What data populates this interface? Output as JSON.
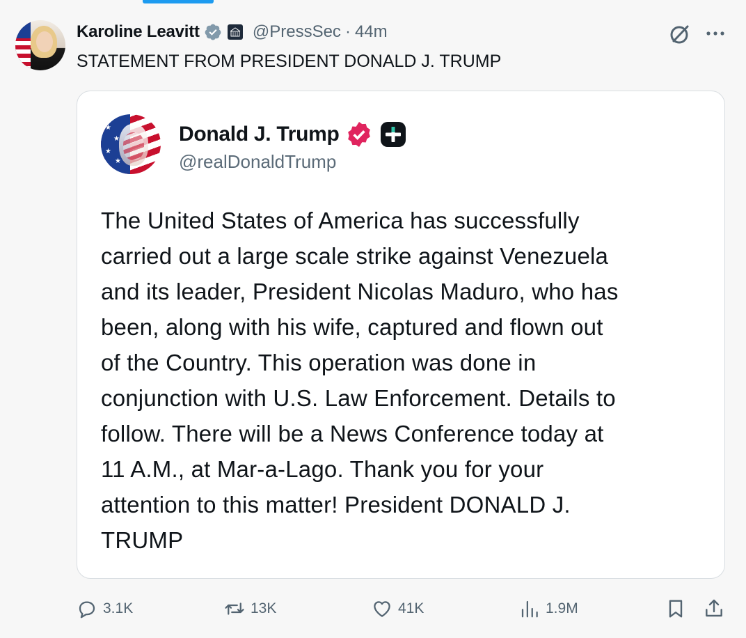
{
  "tab_indicator_color": "#1d9bf0",
  "post": {
    "author_name": "Karoline Leavitt",
    "author_handle": "@PressSec",
    "separator": "·",
    "time": "44m",
    "affiliate_badge_text": "THE WHITE HOUSE",
    "text": "STATEMENT FROM PRESIDENT DONALD J. TRUMP"
  },
  "quoted": {
    "author_name": "Donald J. Trump",
    "author_handle": "@realDonaldTrump",
    "lines": [
      "The United States of America has successfully",
      "carried out a large scale strike against Venezuela",
      "and its leader, President Nicolas Maduro, who has",
      "been, along with his wife, captured and flown out",
      "of the Country. This operation was done in",
      "conjunction with U.S. Law Enforcement. Details to",
      "follow. There will be a News Conference today at",
      "11 A.M., at Mar-a-Lago. Thank you for your",
      "attention to this matter! President DONALD J.",
      "TRUMP"
    ]
  },
  "actions": {
    "replies": "3.1K",
    "reposts": "13K",
    "likes": "41K",
    "views": "1.9M"
  },
  "icons": {
    "verified_gray": "verified-gray-icon",
    "verified_pink": "verified-pink-icon",
    "grok": "grok-icon",
    "more": "more-icon",
    "reply": "reply-icon",
    "repost": "repost-icon",
    "like": "like-icon",
    "views": "views-icon",
    "bookmark": "bookmark-icon",
    "share": "share-icon"
  },
  "colors": {
    "text": "#0f1419",
    "secondary": "#536471",
    "verified_gray": "#829aab",
    "verified_pink": "#e0245e"
  }
}
